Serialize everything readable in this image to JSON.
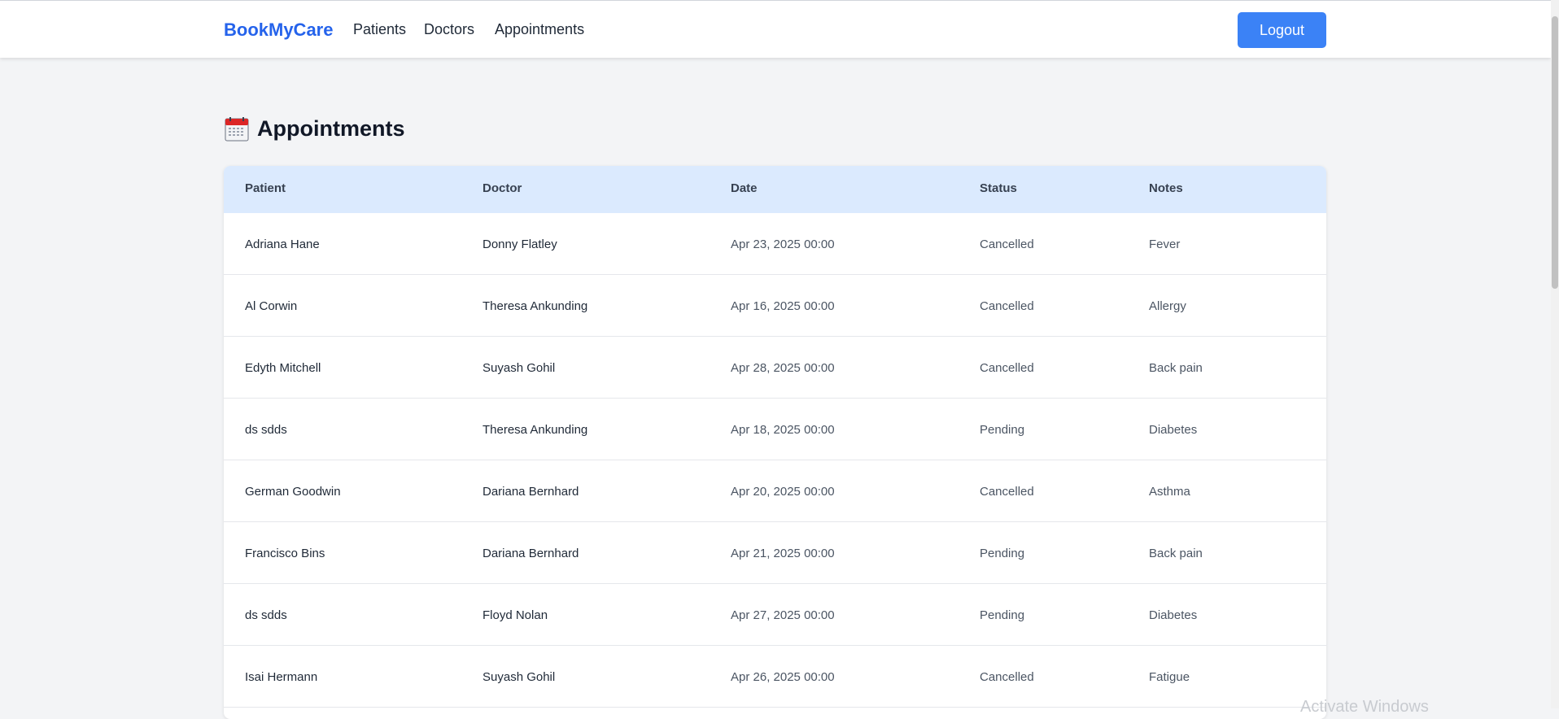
{
  "header": {
    "brand": "BookMyCare",
    "nav": [
      "Patients",
      "Doctors",
      "Appointments"
    ],
    "logout_label": "Logout"
  },
  "page": {
    "title": "Appointments",
    "icon": "calendar-icon"
  },
  "table": {
    "columns": [
      "Patient",
      "Doctor",
      "Date",
      "Status",
      "Notes"
    ],
    "rows": [
      [
        "Adriana Hane",
        "Donny Flatley",
        "Apr 23, 2025 00:00",
        "Cancelled",
        "Fever"
      ],
      [
        "Al Corwin",
        "Theresa Ankunding",
        "Apr 16, 2025 00:00",
        "Cancelled",
        "Allergy"
      ],
      [
        "Edyth Mitchell",
        "Suyash Gohil",
        "Apr 28, 2025 00:00",
        "Cancelled",
        "Back pain"
      ],
      [
        "ds sdds",
        "Theresa Ankunding",
        "Apr 18, 2025 00:00",
        "Pending",
        "Diabetes"
      ],
      [
        "German Goodwin",
        "Dariana Bernhard",
        "Apr 20, 2025 00:00",
        "Cancelled",
        "Asthma"
      ],
      [
        "Francisco Bins",
        "Dariana Bernhard",
        "Apr 21, 2025 00:00",
        "Pending",
        "Back pain"
      ],
      [
        "ds sdds",
        "Floyd Nolan",
        "Apr 27, 2025 00:00",
        "Pending",
        "Diabetes"
      ],
      [
        "Isai Hermann",
        "Suyash Gohil",
        "Apr 26, 2025 00:00",
        "Cancelled",
        "Fatigue"
      ]
    ]
  },
  "watermark": "Activate Windows",
  "colors": {
    "brand": "#2563eb",
    "button": "#3b82f6",
    "table_header_bg": "#dbeafe",
    "page_bg": "#f3f4f6"
  }
}
